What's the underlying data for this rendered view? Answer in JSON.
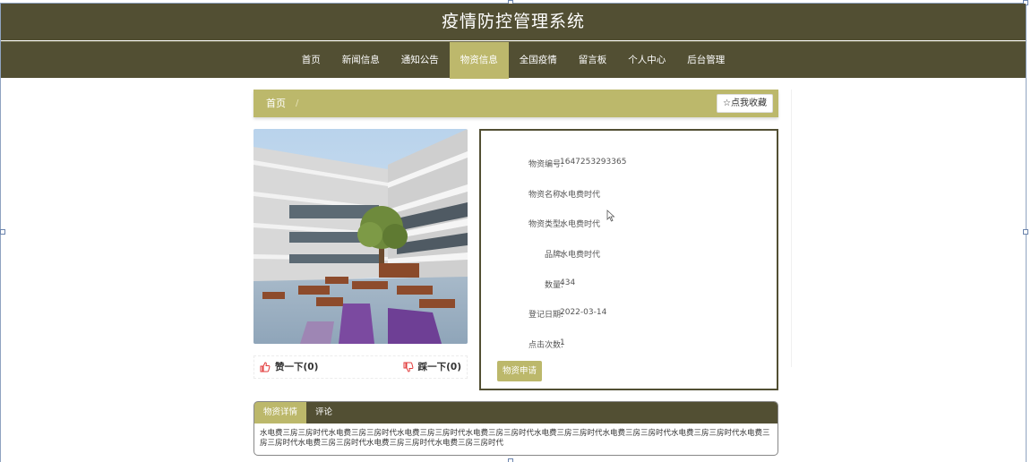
{
  "site": {
    "title": "疫情防控管理系统"
  },
  "nav": {
    "items": [
      "首页",
      "新闻信息",
      "通知公告",
      "物资信息",
      "全国疫情",
      "留言板",
      "个人中心",
      "后台管理"
    ],
    "active_index": 3
  },
  "breadcrumb": {
    "home": "首页",
    "separator": "/"
  },
  "favorite": {
    "label": "☆点我收藏"
  },
  "reactions": {
    "like": "赞一下(0)",
    "dislike": "踩一下(0)"
  },
  "details": {
    "fields": [
      {
        "label": "物资编号:",
        "value": "1647253293365"
      },
      {
        "label": "物资名称:",
        "value": "水电费时代"
      },
      {
        "label": "物资类型:",
        "value": "水电费时代"
      },
      {
        "label": "品牌:",
        "value": "水电费时代"
      },
      {
        "label": "数量:",
        "value": "434"
      },
      {
        "label": "登记日期:",
        "value": "2022-03-14"
      },
      {
        "label": "点击次数:",
        "value": "1"
      }
    ],
    "apply_button": "物资申请"
  },
  "tabs": {
    "items": [
      "物资详情",
      "评论"
    ],
    "active_index": 0,
    "content": "水电费三房三房时代水电费三房三房时代水电费三房三房时代水电费三房三房时代水电费三房三房时代水电费三房三房时代水电费三房三房时代水电费三房三房时代水电费三房三房时代水电费三房三房时代水电费三房三房时代"
  },
  "colors": {
    "header_bg": "#524f33",
    "accent": "#bcb86b"
  }
}
